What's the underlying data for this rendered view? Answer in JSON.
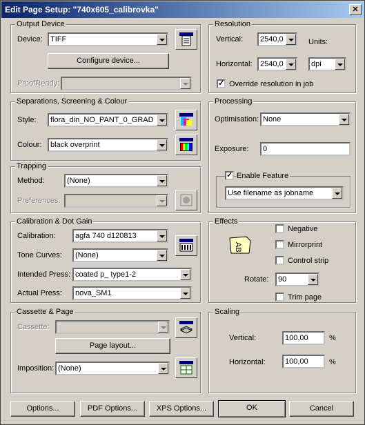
{
  "title": "Edit Page Setup: \"740x605_calibrovka\"",
  "output_device": {
    "group_title": "Output Device",
    "device_label": "Device:",
    "device_value": "TIFF",
    "configure_button": "Configure device...",
    "proofready_label": "ProofReady:",
    "proofready_value": ""
  },
  "separations": {
    "group_title": "Separations, Screening & Colour",
    "style_label": "Style:",
    "style_value": "flora_din_NO_PANT_0_GRAD",
    "colour_label": "Colour:",
    "colour_value": "black overprint"
  },
  "trapping": {
    "group_title": "Trapping",
    "method_label": "Method:",
    "method_value": "(None)",
    "preferences_label": "Preferences:",
    "preferences_value": ""
  },
  "calibration": {
    "group_title": "Calibration & Dot Gain",
    "calibration_label": "Calibration:",
    "calibration_value": "agfa 740 d120813",
    "tone_curves_label": "Tone Curves:",
    "tone_curves_value": "(None)",
    "intended_press_label": "Intended Press:",
    "intended_press_value": "coated p_ type1-2",
    "actual_press_label": "Actual Press:",
    "actual_press_value": "nova_SM1"
  },
  "cassette": {
    "group_title": "Cassette & Page",
    "cassette_label": "Cassette:",
    "cassette_value": "",
    "page_layout_button": "Page layout...",
    "imposition_label": "Imposition:",
    "imposition_value": "(None)"
  },
  "resolution": {
    "group_title": "Resolution",
    "vertical_label": "Vertical:",
    "vertical_value": "2540,0",
    "units_label": "Units:",
    "horizontal_label": "Horizontal:",
    "horizontal_value": "2540,0",
    "units_value": "dpi",
    "override_label": "Override resolution in job",
    "override_checked": true
  },
  "processing": {
    "group_title": "Processing",
    "optimisation_label": "Optimisation:",
    "optimisation_value": "None",
    "exposure_label": "Exposure:",
    "exposure_value": "0",
    "enable_feature_label": "Enable Feature",
    "enable_feature_checked": true,
    "feature_value": "Use filename as jobname"
  },
  "effects": {
    "group_title": "Effects",
    "negative_label": "Negative",
    "mirrorprint_label": "Mirrorprint",
    "control_strip_label": "Control strip",
    "rotate_label": "Rotate:",
    "rotate_value": "90",
    "trim_page_label": "Trim page"
  },
  "scaling": {
    "group_title": "Scaling",
    "vertical_label": "Vertical:",
    "vertical_value": "100,00",
    "horizontal_label": "Horizontal:",
    "horizontal_value": "100,00",
    "percent": "%"
  },
  "buttons": {
    "options": "Options...",
    "pdf_options": "PDF Options...",
    "xps_options": "XPS Options...",
    "ok": "OK",
    "cancel": "Cancel"
  }
}
